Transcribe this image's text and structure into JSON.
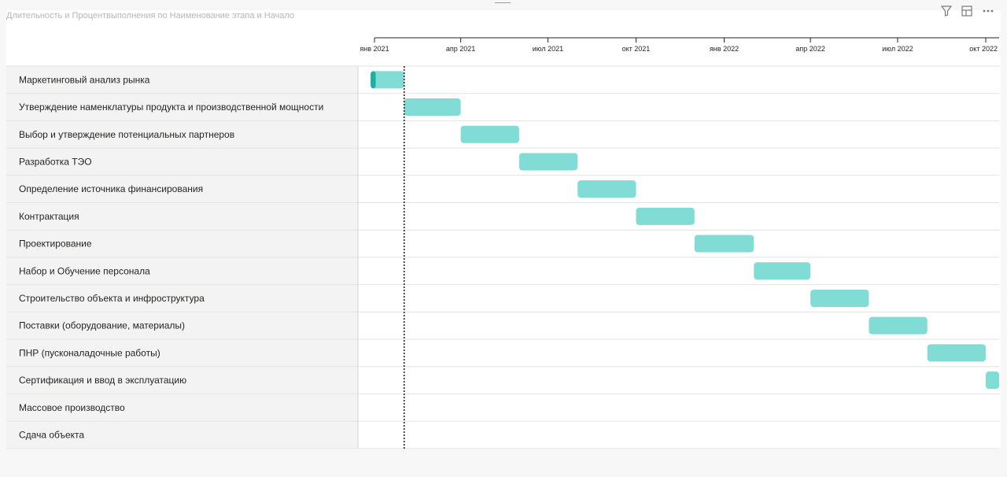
{
  "visual_title": "Длительность и Процентвыполнения по Наименование этапа и Начало",
  "header_icons": [
    "filter-icon",
    "focus-mode-icon",
    "more-options-icon"
  ],
  "chart_data": {
    "type": "gantt",
    "title": "Длительность и Процентвыполнения по Наименование этапа и Начало",
    "x_axis": {
      "range": [
        "2020-12-01",
        "2022-10-31"
      ],
      "ticks": [
        {
          "date": "2021-01-01",
          "label": "янв 2021"
        },
        {
          "date": "2021-04-01",
          "label": "апр 2021"
        },
        {
          "date": "2021-07-01",
          "label": "июл 2021"
        },
        {
          "date": "2021-10-01",
          "label": "окт 2021"
        },
        {
          "date": "2022-01-01",
          "label": "янв 2022"
        },
        {
          "date": "2022-04-01",
          "label": "апр 2022"
        },
        {
          "date": "2022-07-01",
          "label": "июл 2022"
        },
        {
          "date": "2022-10-01",
          "label": "окт 2022"
        }
      ]
    },
    "today_marker": "2021-02-01",
    "bar_color": "#80dcd4",
    "progress_color": "#15b2a5",
    "tasks": [
      {
        "name": "Маркетинговый анализ рынка",
        "start": "2020-12-28",
        "end": "2021-02-01",
        "progress": 0.15
      },
      {
        "name": "Утверждение наменклатуры продукта и производственной мощности",
        "start": "2021-02-01",
        "end": "2021-04-01",
        "progress": 0
      },
      {
        "name": "Выбор и утверждение потенциальных партнеров",
        "start": "2021-04-01",
        "end": "2021-06-01",
        "progress": 0
      },
      {
        "name": "Разработка ТЭО",
        "start": "2021-06-01",
        "end": "2021-08-01",
        "progress": 0
      },
      {
        "name": "Определение источника финансирования",
        "start": "2021-08-01",
        "end": "2021-10-01",
        "progress": 0
      },
      {
        "name": "Контрактация",
        "start": "2021-10-01",
        "end": "2021-12-01",
        "progress": 0
      },
      {
        "name": "Проектирование",
        "start": "2021-12-01",
        "end": "2022-02-01",
        "progress": 0
      },
      {
        "name": "Набор и Обучение персонала",
        "start": "2022-02-01",
        "end": "2022-04-01",
        "progress": 0
      },
      {
        "name": "Строительство объекта и инфроструктура",
        "start": "2022-04-01",
        "end": "2022-06-01",
        "progress": 0
      },
      {
        "name": "Поставки (оборудование, материалы)",
        "start": "2022-06-01",
        "end": "2022-08-01",
        "progress": 0
      },
      {
        "name": "ПНР (пусконаладочные работы)",
        "start": "2022-08-01",
        "end": "2022-10-01",
        "progress": 0
      },
      {
        "name": "Сертификация и ввод в эксплуатацию",
        "start": "2022-10-01",
        "end": "2022-12-01",
        "progress": 0
      },
      {
        "name": "Массовое производство",
        "start": null,
        "end": null,
        "progress": 0
      },
      {
        "name": "Сдача объекта",
        "start": null,
        "end": null,
        "progress": 0
      }
    ]
  }
}
